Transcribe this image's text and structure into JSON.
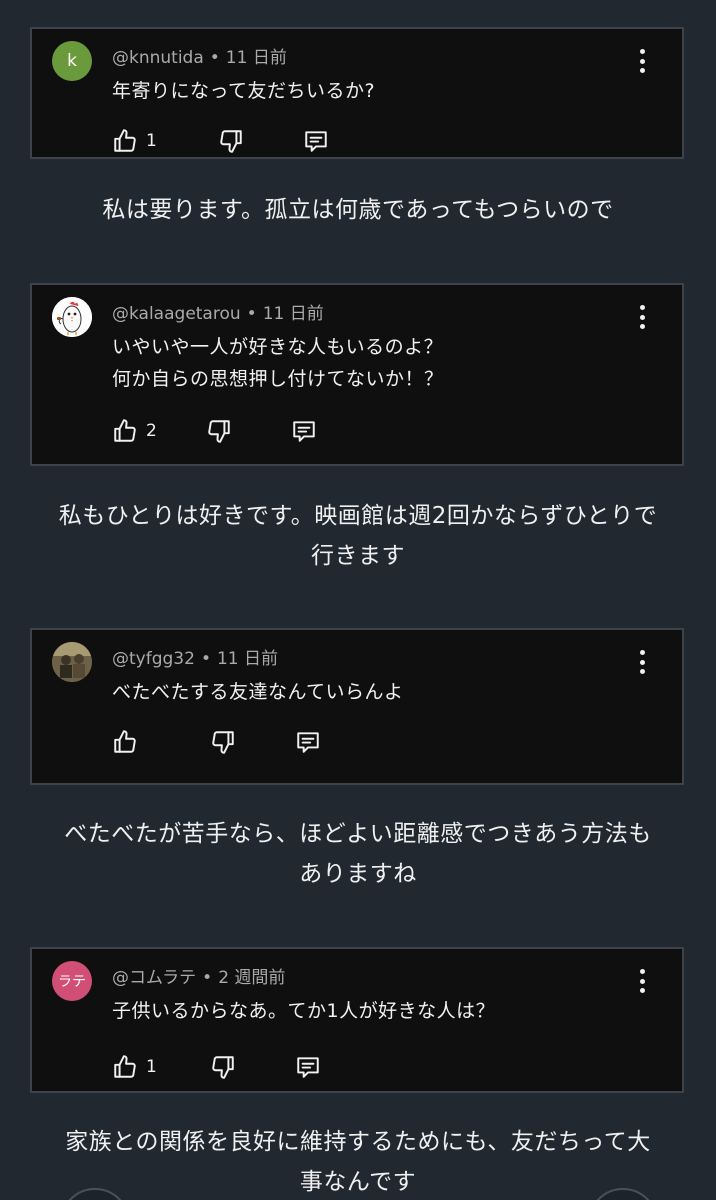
{
  "comments": [
    {
      "avatar_text": "k",
      "avatar_color": "#6b9a3c",
      "handle": "@knnutida",
      "time": "11 日前",
      "text_lines": [
        "年寄りになって友だちいるか?"
      ],
      "likes": "1"
    },
    {
      "avatar_text": "",
      "avatar_color": "#ffffff",
      "handle": "@kalaagetarou",
      "time": "11 日前",
      "text_lines": [
        "いやいや一人が好きな人もいるのよ？",
        "何か自らの思想押し付けてないか！？"
      ],
      "likes": "2"
    },
    {
      "avatar_text": "",
      "avatar_color": "#6d6248",
      "handle": "@tyfgg32",
      "time": "11 日前",
      "text_lines": [
        "べたべたする友達なんていらんよ"
      ],
      "likes": ""
    },
    {
      "avatar_text": "ラテ",
      "avatar_color": "#d14e76",
      "handle": "@コムラテ",
      "time": "2 週間前",
      "text_lines": [
        "子供いるからなあ。てか1人が好きな人は？"
      ],
      "likes": "1"
    }
  ],
  "replies": [
    [
      "私は要ります。孤立は何歳であってもつらいので"
    ],
    [
      "私もひとりは好きです。映画館は週2回かならずひとりで",
      "行きます"
    ],
    [
      "べたべたが苦手なら、ほどよい距離感でつきあう方法も",
      "ありますね"
    ],
    [
      "家族との関係を良好に維持するためにも、友だちって大",
      "事なんです"
    ]
  ],
  "separator": "•",
  "icons": {
    "like": "thumbs-up-icon",
    "dislike": "thumbs-down-icon",
    "reply": "comment-icon",
    "more": "more-vert-icon"
  },
  "colors": {
    "background": "#212830",
    "card": "#0f0f0f",
    "card_border": "#3e434a",
    "meta_text": "#aaaaaa",
    "body_text": "#f1f1f1"
  }
}
